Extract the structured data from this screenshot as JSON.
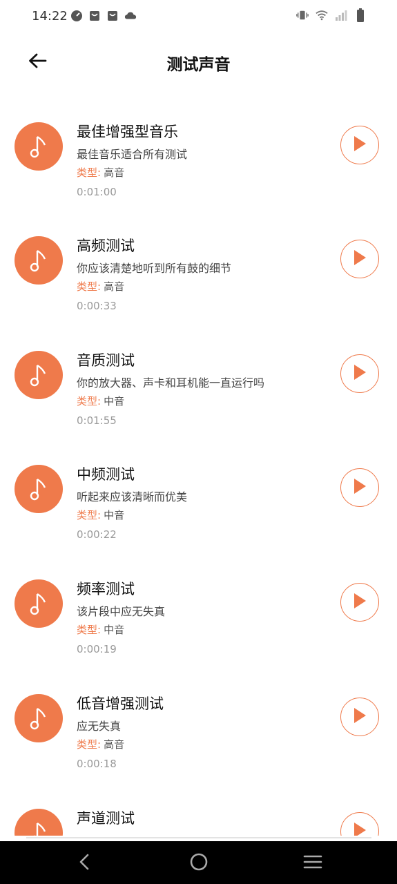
{
  "status_bar": {
    "time": "14:22",
    "left_icons": [
      "speedometer-icon",
      "shopping-bag-icon",
      "shopping-bag-icon",
      "cloud-icon"
    ],
    "right_icons": [
      "vibrate-icon",
      "wifi-icon",
      "signal-icon",
      "battery-icon"
    ]
  },
  "header": {
    "title": "测试声音",
    "back_icon": "arrow-left-icon"
  },
  "colors": {
    "accent": "#EF7A4B",
    "nav_bar": "#000000"
  },
  "items": [
    {
      "title": "最佳增强型音乐",
      "desc": "最佳音乐适合所有测试",
      "type_label": "类型:",
      "type_value": "高音",
      "duration": "0:01:00"
    },
    {
      "title": "高频测试",
      "desc": "你应该清楚地听到所有鼓的细节",
      "type_label": "类型:",
      "type_value": "高音",
      "duration": "0:00:33"
    },
    {
      "title": "音质测试",
      "desc": "你的放大器、声卡和耳机能一直运行吗",
      "type_label": "类型:",
      "type_value": "中音",
      "duration": "0:01:55"
    },
    {
      "title": "中频测试",
      "desc": "听起来应该清晰而优美",
      "type_label": "类型:",
      "type_value": "中音",
      "duration": "0:00:22"
    },
    {
      "title": "频率测试",
      "desc": "该片段中应无失真",
      "type_label": "类型:",
      "type_value": "中音",
      "duration": "0:00:19"
    },
    {
      "title": "低音增强测试",
      "desc": "应无失真",
      "type_label": "类型:",
      "type_value": "高音",
      "duration": "0:00:18"
    },
    {
      "title": "声道测试",
      "desc": "",
      "type_label": "",
      "type_value": "",
      "duration": ""
    }
  ],
  "nav_bar": {
    "icons": [
      "back-triangle-icon",
      "home-circle-icon",
      "menu-lines-icon"
    ]
  }
}
